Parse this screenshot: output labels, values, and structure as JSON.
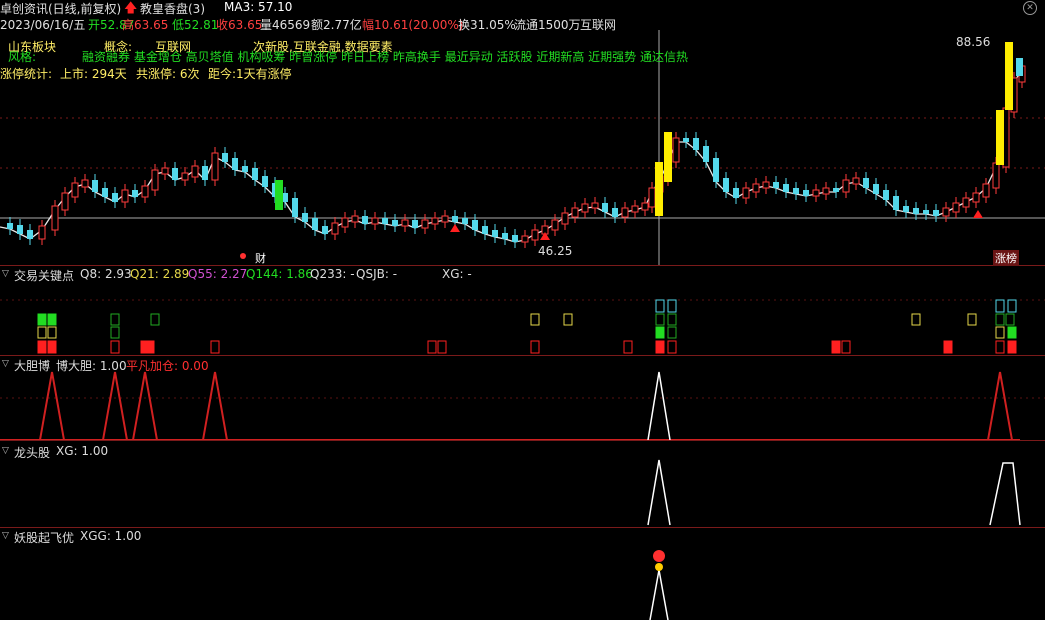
{
  "colors": {
    "up": "#ff3c3c",
    "down": "#54d8ea",
    "ma": "#e8e8e8",
    "green": "#22dd22",
    "yellow": "#ffee00"
  },
  "header": {
    "title": "卓创资讯(日线,前复权)",
    "indicator": "教皇香盘(3)",
    "ma3": "MA3: 57.10",
    "date": "2023/06/16/五",
    "open": "开52.87",
    "high": "高63.65",
    "low": "低52.81",
    "close": "收63.65",
    "volume": "量46569",
    "amount": "额2.77亿",
    "change": "幅10.61(20.00%)",
    "turnover": "换31.05%",
    "float": "流通1500万",
    "sector": "互联网"
  },
  "info": {
    "board_label": "山东板块",
    "concept_label": "概念:",
    "concept_value": "互联网",
    "tags1": "次新股,互联金融,数据要素",
    "style_label": "风格:",
    "style_tags": "融资融券 基金增仓 高贝塔值 机构吸筹 昨曾涨停 昨日上榜 昨高换手 最近异动 活跃股 近期新高 近期强势 通达信热",
    "limit_stats": "涨停统计:",
    "listed": "上市: 294天",
    "limit_count": "共涨停: 6次",
    "distance": "距今:1天有涨停"
  },
  "price_labels": {
    "high": "88.56",
    "low": "46.25"
  },
  "markers": {
    "cai": "财",
    "zhangbang": "涨榜"
  },
  "panels": {
    "p1": {
      "name": "交易关键点",
      "q8": "Q8: 2.93",
      "q21": "Q21: 2.89",
      "q55": "Q55: 2.27",
      "q144": "Q144: 1.86",
      "q233": "Q233: -",
      "qsjb": "QSJB: -",
      "xg": "XG: -"
    },
    "p2": {
      "name": "大胆博",
      "label1": "博大胆: 1.00",
      "label2": "平凡加仓: 0.00"
    },
    "p3": {
      "name": "龙头股",
      "label1": "XG: 1.00"
    },
    "p4": {
      "name": "妖股起飞优",
      "label1": "XGG: 1.00"
    }
  }
}
